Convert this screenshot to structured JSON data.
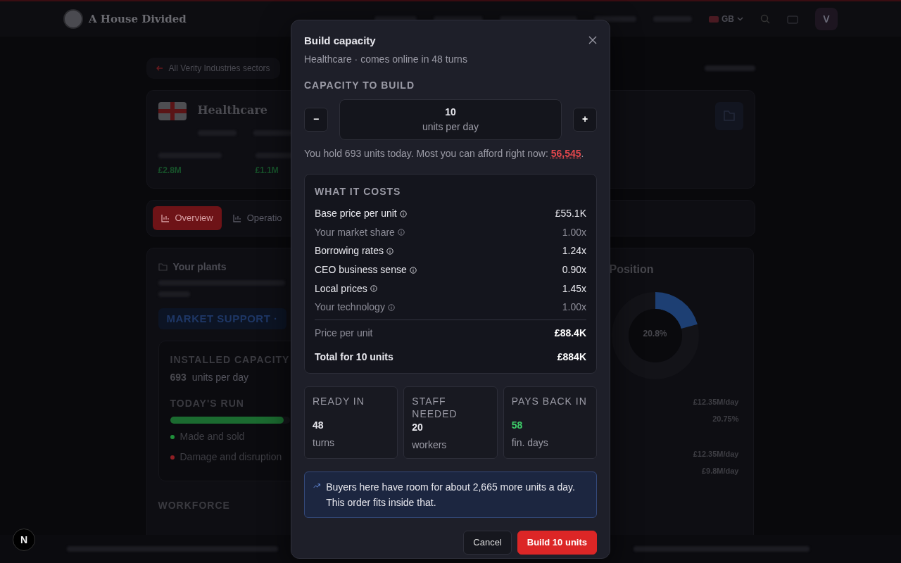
{
  "navbar": {
    "brand": "A House Divided",
    "region": "GB",
    "avatar": "V"
  },
  "breadcrumb": {
    "label": "All Verity Industries sectors"
  },
  "sector": {
    "title": "Healthcare",
    "stats": [
      {
        "value": "£2.8M"
      },
      {
        "value": "£1.1M"
      }
    ]
  },
  "tabs": [
    {
      "label": "Overview",
      "selected": true
    },
    {
      "label": "Operatio",
      "selected": false
    }
  ],
  "plants": {
    "title": "Your plants",
    "support_chip": "MARKET SUPPORT ·",
    "installed_label": "INSTALLED CAPACITY",
    "installed_value": "693",
    "installed_unit": "units per day",
    "run": {
      "label": "TODAY'S RUN",
      "level": 0.95
    },
    "legend": [
      {
        "label": "Made and sold",
        "color": "#1f8f3a"
      },
      {
        "label": "Damage and disruption",
        "color": "#8f1f24"
      }
    ],
    "workforce_label": "WORKFORCE"
  },
  "position": {
    "title": "Position",
    "share": "20.8%",
    "rows": [
      {
        "value": "£12.35M/day"
      },
      {
        "value": "20.75%"
      },
      {
        "value": "£12.35M/day"
      },
      {
        "value": "£9.8M/day"
      }
    ]
  },
  "dev_badge": "N",
  "modal": {
    "title": "Build capacity",
    "subtitle": "Healthcare · comes online in 48 turns",
    "capacity_label": "CAPACITY TO BUILD",
    "decrement": "−",
    "increment": "+",
    "quantity": "10",
    "quantity_unit": "units per day",
    "hold_note": "You hold 693 units today. Most you can afford right now: ",
    "afford_value": "56,545",
    "hold_note_end": ".",
    "costs_title": "WHAT IT COSTS",
    "costs": [
      {
        "kind": "factor",
        "label": "Base price per unit",
        "value": "£55.1K",
        "muted": false
      },
      {
        "kind": "factor",
        "label": "Your market share",
        "value": "1.00x",
        "muted": true
      },
      {
        "kind": "factor",
        "label": "Borrowing rates",
        "value": "1.24x",
        "muted": false
      },
      {
        "kind": "factor",
        "label": "CEO business sense",
        "value": "0.90x",
        "muted": false
      },
      {
        "kind": "factor",
        "label": "Local prices",
        "value": "1.45x",
        "muted": false
      },
      {
        "kind": "factor",
        "label": "Your technology",
        "value": "1.00x",
        "muted": true
      },
      {
        "kind": "subtotal",
        "label": "Price per unit",
        "value": "£88.4K"
      },
      {
        "kind": "total",
        "label": "Total for 10 units",
        "value": "£884K"
      }
    ],
    "stats": [
      {
        "label": "READY IN",
        "value": "48",
        "unit": "turns",
        "highlight": false
      },
      {
        "label": "STAFF NEEDED",
        "value": "20",
        "unit": "workers",
        "highlight": false
      },
      {
        "label": "PAYS BACK IN",
        "value": "58",
        "unit": "fin. days",
        "highlight": true
      }
    ],
    "notice": "Buyers here have room for about 2,665 more units a day. This order fits inside that.",
    "buttons": [
      {
        "kind": "secondary",
        "label": "Cancel"
      },
      {
        "kind": "primary",
        "label": "Build 10 units"
      }
    ]
  }
}
